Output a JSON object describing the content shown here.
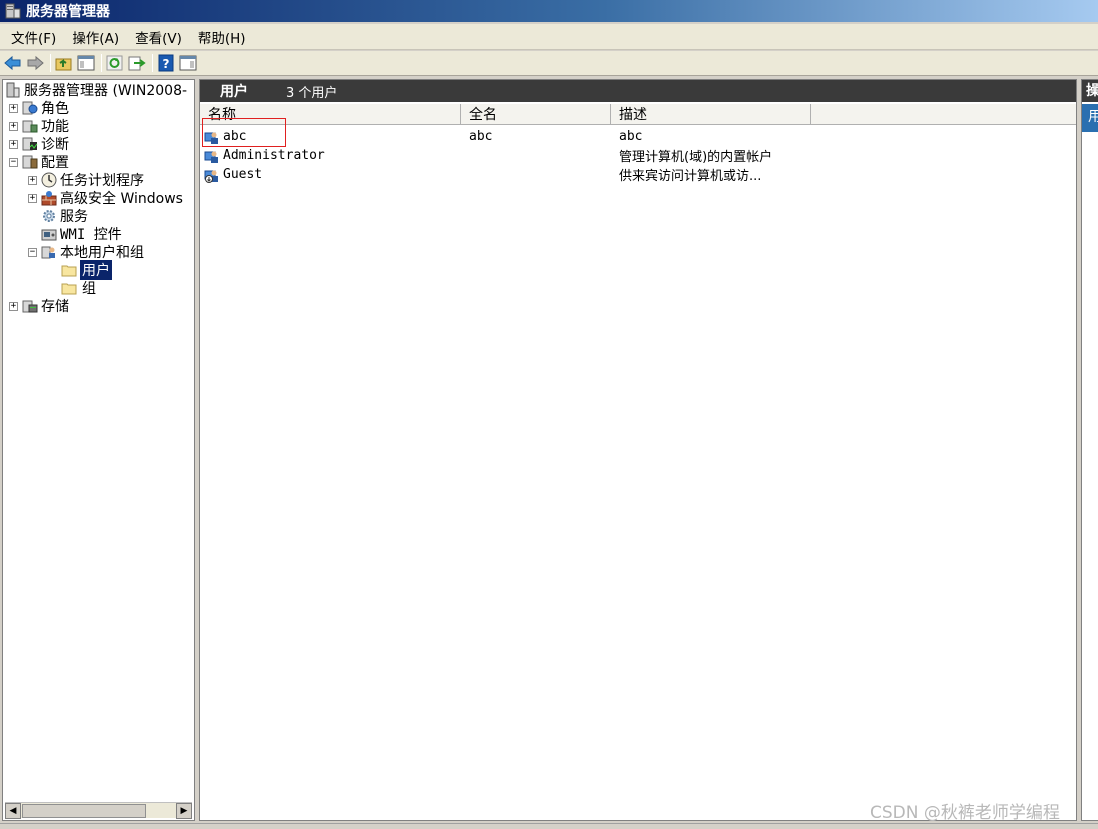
{
  "window": {
    "title": "服务器管理器"
  },
  "menu": [
    "文件(F)",
    "操作(A)",
    "查看(V)",
    "帮助(H)"
  ],
  "toolbar": {
    "buttons": [
      "back-arrow-icon",
      "forward-arrow-icon",
      "up-folder-icon",
      "show-hide-tree-icon",
      "refresh-icon",
      "export-list-icon",
      "help-icon",
      "show-hide-action-pane-icon"
    ]
  },
  "tree": {
    "root": "服务器管理器 (WIN2008-",
    "roles": "角色",
    "features": "功能",
    "diagnostics": "诊断",
    "configuration": "配置",
    "task_scheduler": "任务计划程序",
    "firewall": "高级安全 Windows",
    "services": "服务",
    "wmi": "WMI 控件",
    "local_users_groups": "本地用户和组",
    "users": "用户",
    "groups": "组",
    "storage": "存储",
    "expander_plus": "+",
    "expander_minus": "−"
  },
  "center": {
    "title": "用户",
    "count": "3 个用户",
    "columns": {
      "name": "名称",
      "fullname": "全名",
      "description": "描述"
    },
    "rows": [
      {
        "name": "abc",
        "fullname": "abc",
        "description": "abc"
      },
      {
        "name": "Administrator",
        "fullname": "",
        "description": "管理计算机(域)的内置帐户"
      },
      {
        "name": "Guest",
        "fullname": "",
        "description": "供来宾访问计算机或访..."
      }
    ]
  },
  "actions": {
    "header": "操",
    "sub": "用"
  },
  "scrollbar": {
    "left": "◀",
    "right": "▶"
  },
  "watermark": "CSDN @秋裤老师学编程"
}
